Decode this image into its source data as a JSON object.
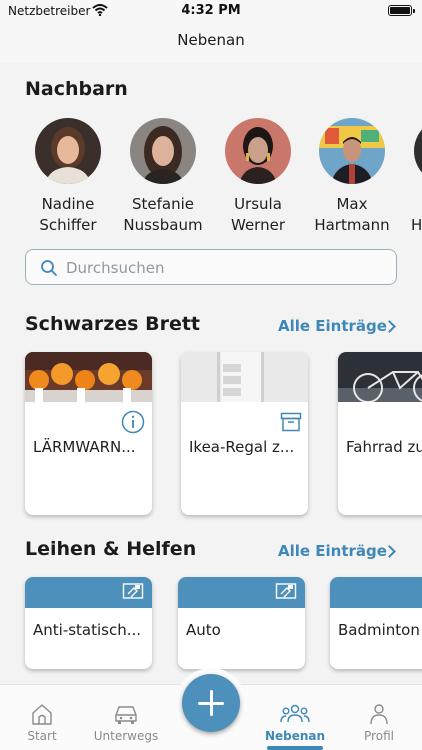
{
  "status_bar": {
    "carrier": "Netzbetreiber",
    "time": "4:32 PM"
  },
  "header": {
    "title": "Nebenan"
  },
  "neighbors": {
    "title": "Nachbarn",
    "items": [
      {
        "first": "Nadine",
        "last": "Schiffer"
      },
      {
        "first": "Stefanie",
        "last": "Nussbaum"
      },
      {
        "first": "Ursula",
        "last": "Werner"
      },
      {
        "first": "Max",
        "last": "Hartmann"
      },
      {
        "first": "",
        "last": "H"
      }
    ]
  },
  "search": {
    "placeholder": "Durchsuchen"
  },
  "board": {
    "title": "Schwarzes Brett",
    "see_all": "Alle Einträge",
    "cards": [
      {
        "title": "LÄRMWARN...",
        "badge": "info-icon"
      },
      {
        "title": "Ikea-Regal z...",
        "badge": "box-icon"
      },
      {
        "title": "Fahrrad zu"
      }
    ]
  },
  "lend": {
    "title": "Leihen & Helfen",
    "see_all": "Alle Einträge",
    "cards": [
      {
        "title": "Anti-statisch..."
      },
      {
        "title": "Auto"
      },
      {
        "title": "Badminton"
      }
    ]
  },
  "tabbar": {
    "tabs": [
      {
        "label": "Start",
        "icon": "home-icon"
      },
      {
        "label": "Unterwegs",
        "icon": "car-icon"
      },
      {
        "label": "Nebenan",
        "icon": "people-icon",
        "active": true
      },
      {
        "label": "Profil",
        "icon": "person-icon"
      }
    ]
  },
  "colors": {
    "accent": "#3e87b7",
    "card_header": "#4d90bb"
  }
}
